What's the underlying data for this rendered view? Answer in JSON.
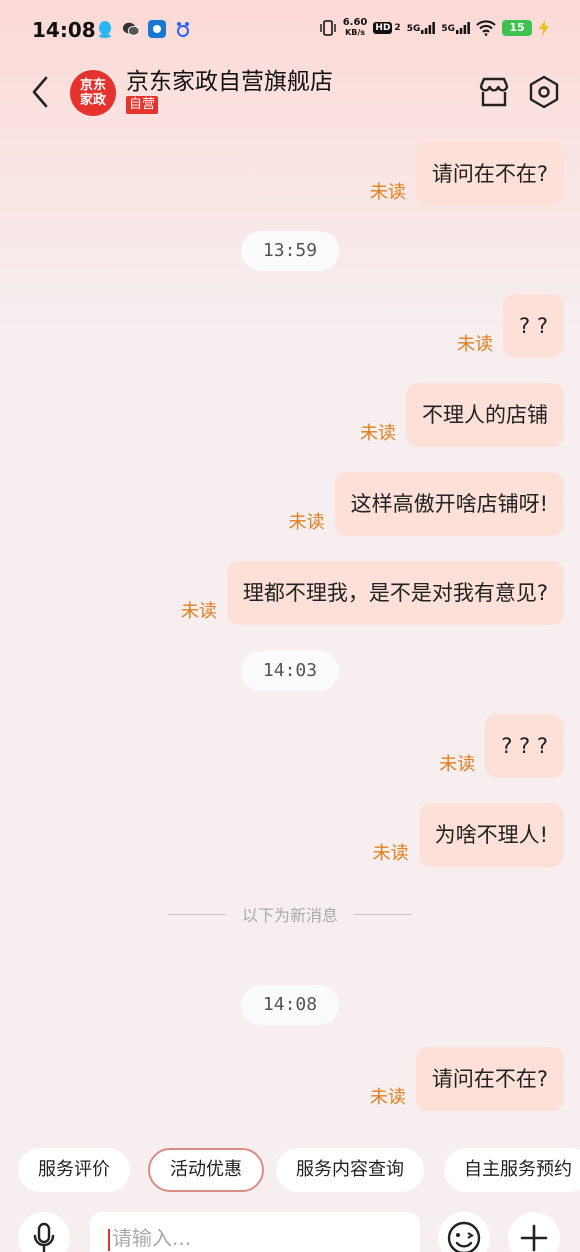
{
  "status_bar": {
    "time": "14:08",
    "net_speed_value": "6.60",
    "net_speed_unit": "KB/s",
    "hd_label": "HD",
    "hd_sub": "2",
    "sig1": "5G",
    "sig2": "5G",
    "battery": "15"
  },
  "header": {
    "logo_line1": "京东",
    "logo_line2": "家政",
    "shop_name": "京东家政自营旗舰店",
    "badge": "自营"
  },
  "messages": [
    {
      "text": "请问在不在?",
      "status": "未读"
    },
    {
      "text": "? ?",
      "status": "未读"
    },
    {
      "text": "不理人的店铺",
      "status": "未读"
    },
    {
      "text": "这样高傲开啥店铺呀!",
      "status": "未读"
    },
    {
      "text": "理都不理我，是不是对我有意见?",
      "status": "未读"
    },
    {
      "text": "? ? ?",
      "status": "未读"
    },
    {
      "text": "为啥不理人!",
      "status": "未读"
    },
    {
      "text": "请问在不在?",
      "status": "未读"
    }
  ],
  "timestamps": [
    "13:59",
    "14:03",
    "14:08"
  ],
  "new_message_divider": "以下为新消息",
  "quick_replies": [
    "服务评价",
    "活动优惠",
    "服务内容查询",
    "自主服务预约"
  ],
  "input": {
    "placeholder": "请输入..."
  },
  "colors": {
    "accent": "#e5322d",
    "bubble": "#fde0d8",
    "unread": "#e07f1c"
  }
}
